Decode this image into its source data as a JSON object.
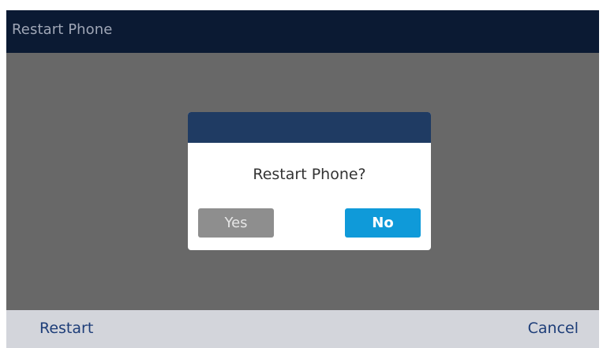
{
  "title_bar": {
    "title": "Restart Phone"
  },
  "dialog": {
    "message": "Restart Phone?",
    "yes_label": "Yes",
    "no_label": "No",
    "selected": "No"
  },
  "softkeys": {
    "left_label": "Restart",
    "right_label": "Cancel"
  },
  "colors": {
    "title_bar": "#0b1a33",
    "dialog_header": "#1f3b63",
    "selected_button": "#0f9ad9",
    "unselected_button": "#8e8e8e",
    "softkey_text": "#1d3d78"
  }
}
